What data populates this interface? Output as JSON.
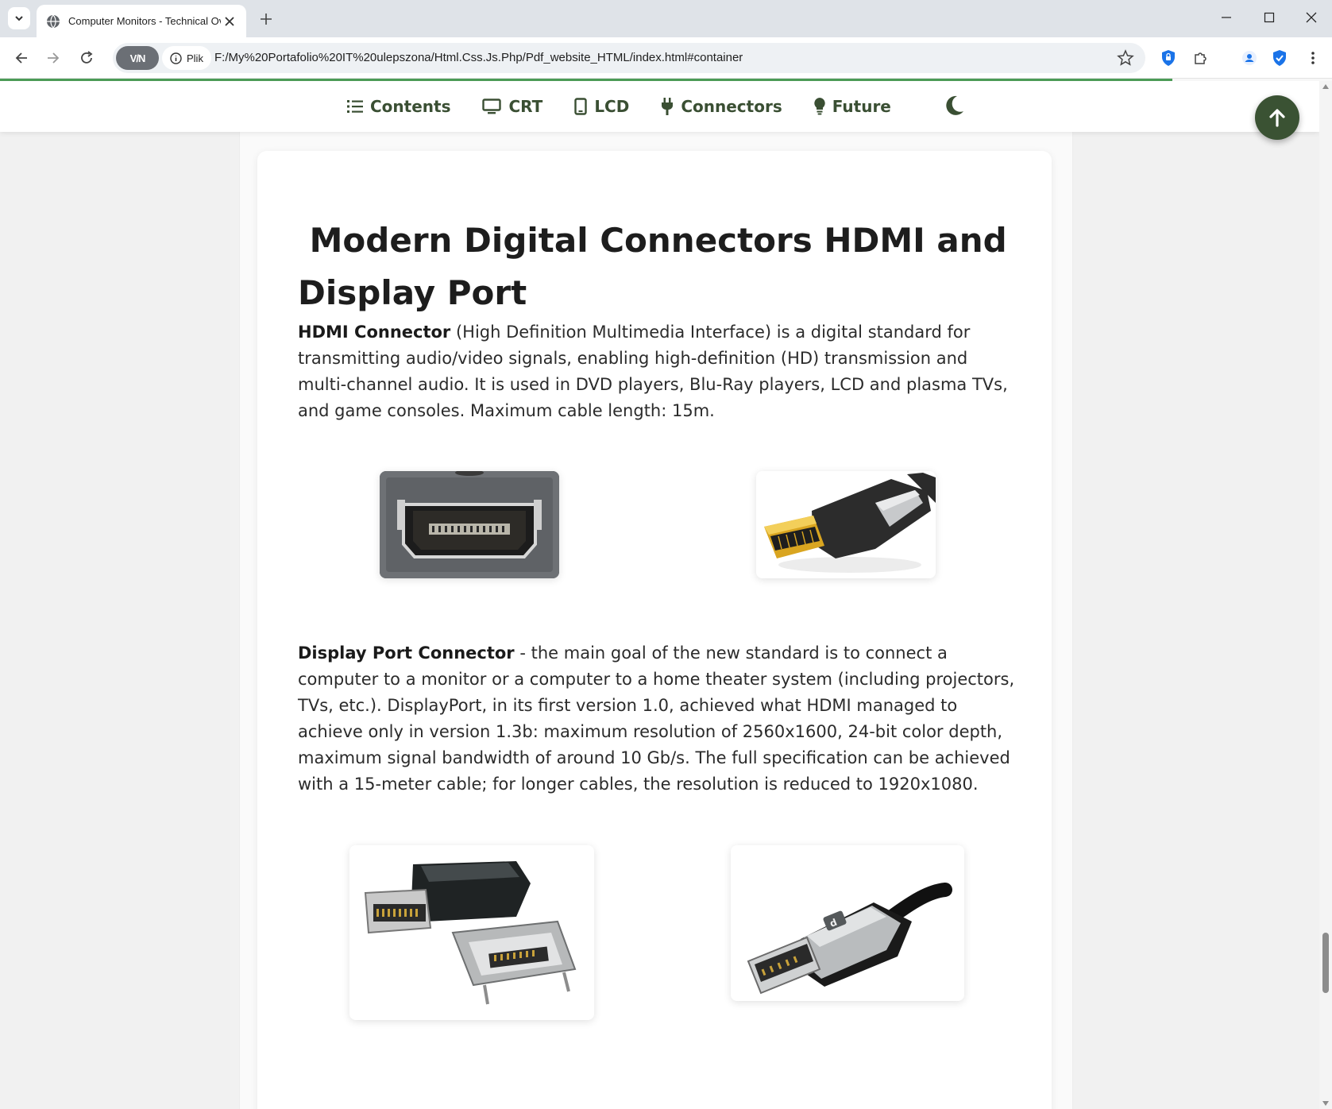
{
  "browser": {
    "tab_title": "Computer Monitors - Technical Ov",
    "vpn_label": "V/N",
    "site_info_label": "Plik",
    "url": "F:/My%20Portafolio%20IT%20ulepszona/Html.Css.Js.Php/Pdf_website_HTML/index.html#container"
  },
  "nav": {
    "items": [
      {
        "label": "Contents",
        "icon": "list-icon"
      },
      {
        "label": "CRT",
        "icon": "monitor-icon"
      },
      {
        "label": "LCD",
        "icon": "tablet-icon"
      },
      {
        "label": "Connectors",
        "icon": "plug-icon"
      },
      {
        "label": "Future",
        "icon": "lightbulb-icon"
      }
    ],
    "theme_icon": "moon-icon",
    "back_to_top_icon": "arrow-up-icon"
  },
  "article": {
    "heading_line1": " Modern Digital Connectors HDMI and",
    "heading_line2": "Display Port",
    "hdmi": {
      "term": "HDMI Connector",
      "text": " (High Definition Multimedia Interface) is a digital standard for transmitting audio/video signals, enabling high-definition (HD) transmission and multi-channel audio. It is used in DVD players, Blu-Ray players, LCD and plasma TVs, and game consoles. Maximum cable length: 15m."
    },
    "displayport": {
      "term": "Display Port Connector",
      "text": " - the main goal of the new standard is to connect a computer to a monitor or a computer to a home theater system (including projectors, TVs, etc.). DisplayPort, in its first version 1.0, achieved what HDMI managed to achieve only in version 1.3b: maximum resolution of 2560x1600, 24-bit color depth, maximum signal bandwidth of around 10 Gb/s. The full specification can be achieved with a 15-meter cable; for longer cables, the resolution is reduced to 1920x1080."
    }
  },
  "colors": {
    "accent": "#3a5233",
    "nav_text": "#3a4f33",
    "progress": "#4b9b56"
  }
}
